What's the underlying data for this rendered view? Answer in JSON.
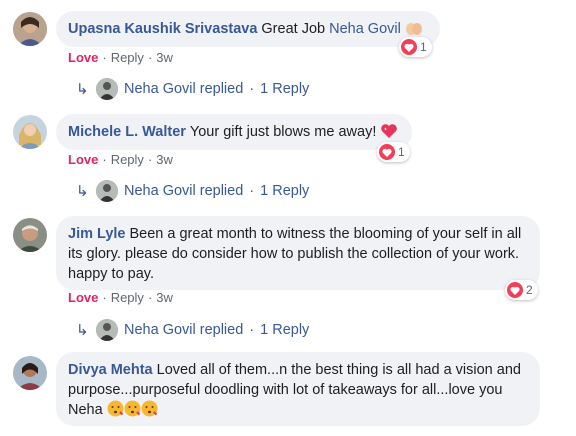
{
  "comments": [
    {
      "author": "Upasna Kaushik Srivastava",
      "text": "Great Job ",
      "tag": "Neha Govil",
      "reaction_label": "Love",
      "reply_label": "Reply",
      "time": "3w",
      "reaction_count": "1",
      "replied_by": "Neha Govil replied",
      "reply_count": "1 Reply"
    },
    {
      "author": "Michele L. Walter",
      "text": "Your gift just blows me away!",
      "reaction_label": "Love",
      "reply_label": "Reply",
      "time": "3w",
      "reaction_count": "1",
      "replied_by": "Neha Govil replied",
      "reply_count": "1 Reply"
    },
    {
      "author": "Jim Lyle",
      "text": "Been a great month to witness the blooming of your self in all its glory. please do consider how to publish the collection of your work. happy to pay.",
      "reaction_label": "Love",
      "reply_label": "Reply",
      "time": "3w",
      "reaction_count": "2",
      "replied_by": "Neha Govil replied",
      "reply_count": "1 Reply"
    },
    {
      "author": "Divya Mehta",
      "text": "Loved all of them...n the best thing is all had a vision and purpose...purposeful doodling with lot of takeaways for all...love you Neha"
    }
  ],
  "separator": "·",
  "colors": {
    "link": "#385898",
    "love": "#e0245e",
    "bubble": "#f0f2f5",
    "meta": "#606770"
  },
  "icons": [
    "heart-icon",
    "reply-arrow-icon",
    "folded-hands-emoji",
    "sparkling-heart-emoji",
    "kissing-face-emoji"
  ]
}
